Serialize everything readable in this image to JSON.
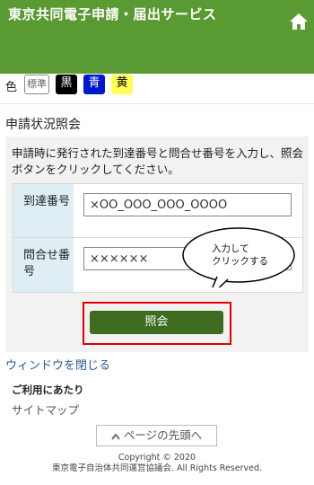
{
  "header": {
    "title": "東京共同電子申請・届出サービス",
    "home_icon": "home-icon"
  },
  "color_switch": {
    "label": "色",
    "options": [
      "標準",
      "黒",
      "青",
      "黄"
    ]
  },
  "section": {
    "title": "申請状況照会",
    "description": "申請時に発行された到達番号と問合せ番号を入力し、照会ボタンをクリックしてください。"
  },
  "form": {
    "arrival_label": "到達番号",
    "arrival_value": "×OO_OOO_OOO_OOOO",
    "inquiry_label": "問合せ番号",
    "inquiry_value": "××××××"
  },
  "callout": {
    "line1": "入力して",
    "line2": "クリックする"
  },
  "search_button": "照会",
  "close_link": "ウィンドウを閉じる",
  "footer": {
    "heading": "ご利用にあたり",
    "sitemap": "サイトマップ",
    "page_top": "ページの先頭へ",
    "copyright": "Copyright © 2020",
    "org": "東京電子自治体共同運営協議会. All Rights Reserved."
  },
  "colors": {
    "header": "#5a9a32",
    "button": "#3d6b1f",
    "highlight": "#e00000",
    "form_label_bg": "#dfeef4"
  }
}
